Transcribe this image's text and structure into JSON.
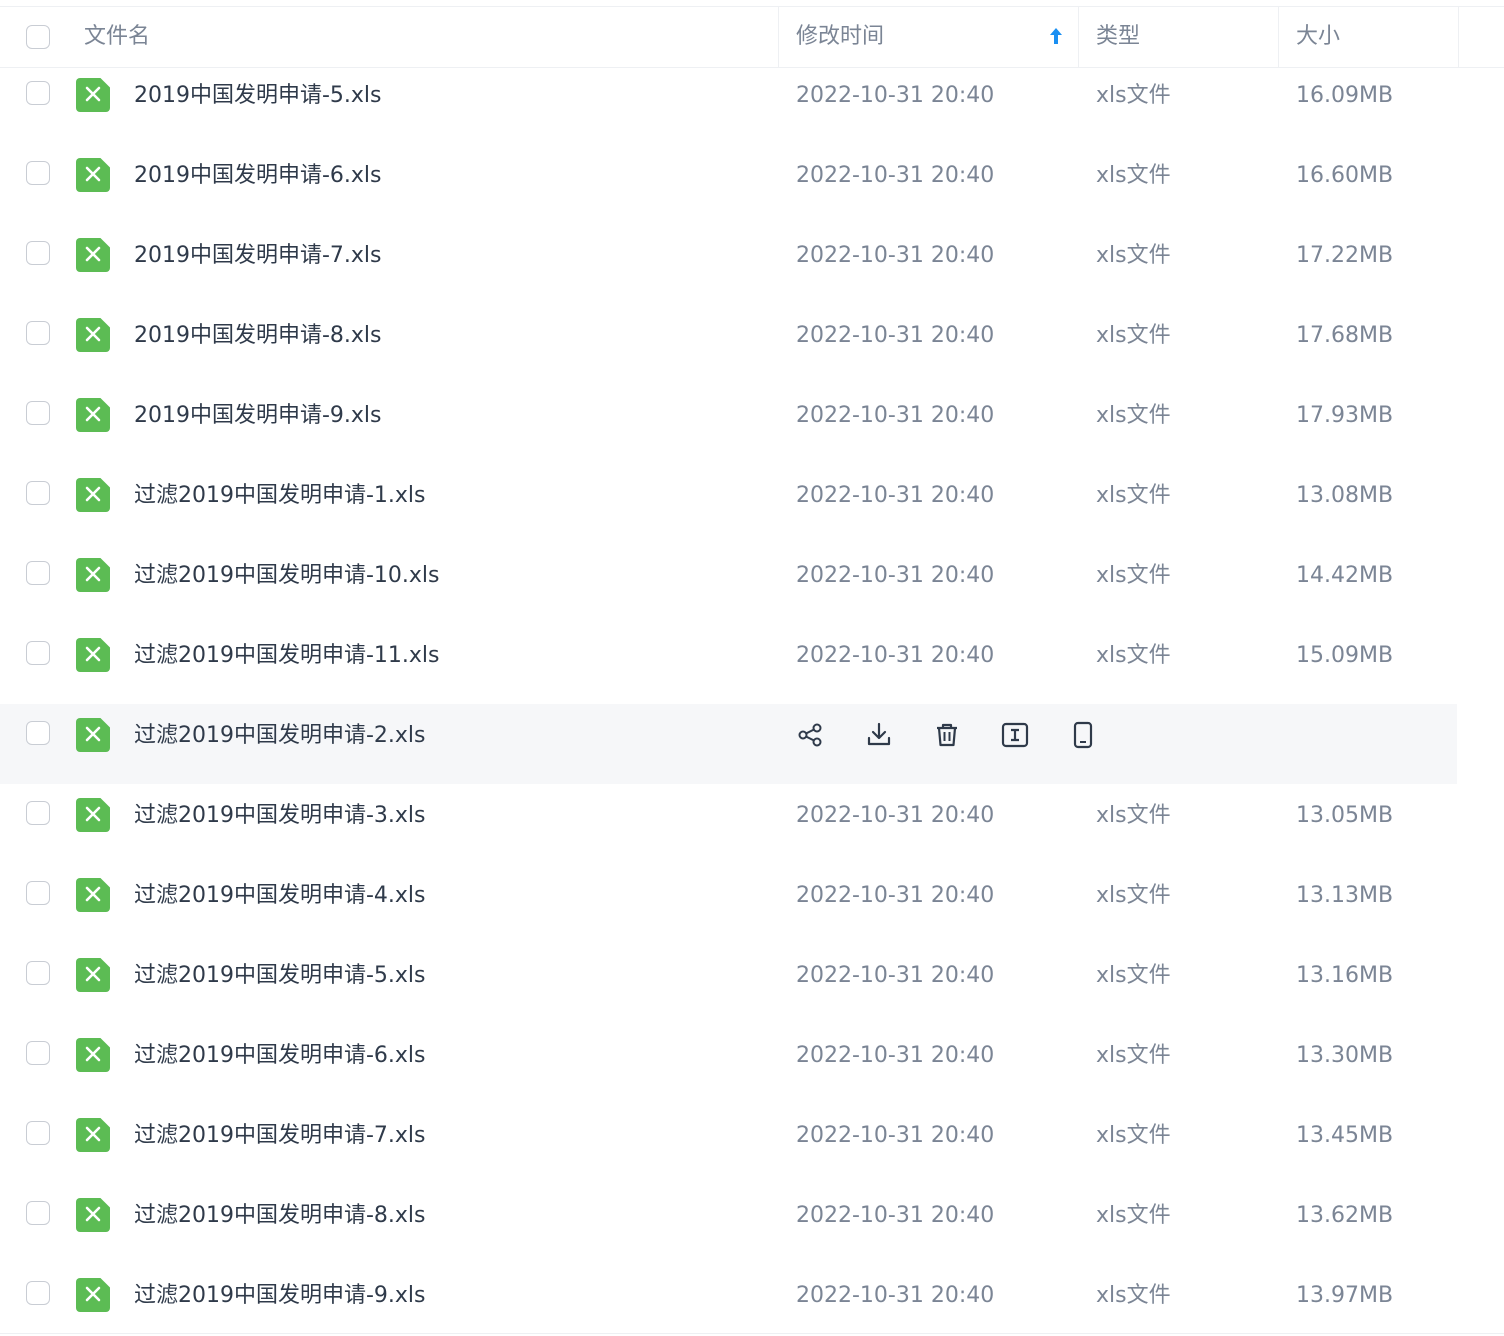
{
  "header": {
    "name_label": "文件名",
    "time_label": "修改时间",
    "type_label": "类型",
    "size_label": "大小"
  },
  "colors": {
    "accent": "#1a8ff2",
    "file_icon": "#5cbc54",
    "hover_row": "#f6f7f9"
  },
  "rows": [
    {
      "name": "2019中国发明申请-5.xls",
      "time": "2022-10-31 20:40",
      "type": "xls文件",
      "size": "16.09MB"
    },
    {
      "name": "2019中国发明申请-6.xls",
      "time": "2022-10-31 20:40",
      "type": "xls文件",
      "size": "16.60MB"
    },
    {
      "name": "2019中国发明申请-7.xls",
      "time": "2022-10-31 20:40",
      "type": "xls文件",
      "size": "17.22MB"
    },
    {
      "name": "2019中国发明申请-8.xls",
      "time": "2022-10-31 20:40",
      "type": "xls文件",
      "size": "17.68MB"
    },
    {
      "name": "2019中国发明申请-9.xls",
      "time": "2022-10-31 20:40",
      "type": "xls文件",
      "size": "17.93MB"
    },
    {
      "name": "过滤2019中国发明申请-1.xls",
      "time": "2022-10-31 20:40",
      "type": "xls文件",
      "size": "13.08MB"
    },
    {
      "name": "过滤2019中国发明申请-10.xls",
      "time": "2022-10-31 20:40",
      "type": "xls文件",
      "size": "14.42MB"
    },
    {
      "name": "过滤2019中国发明申请-11.xls",
      "time": "2022-10-31 20:40",
      "type": "xls文件",
      "size": "15.09MB"
    },
    {
      "name": "过滤2019中国发明申请-2.xls",
      "hover": true
    },
    {
      "name": "过滤2019中国发明申请-3.xls",
      "time": "2022-10-31 20:40",
      "type": "xls文件",
      "size": "13.05MB"
    },
    {
      "name": "过滤2019中国发明申请-4.xls",
      "time": "2022-10-31 20:40",
      "type": "xls文件",
      "size": "13.13MB"
    },
    {
      "name": "过滤2019中国发明申请-5.xls",
      "time": "2022-10-31 20:40",
      "type": "xls文件",
      "size": "13.16MB"
    },
    {
      "name": "过滤2019中国发明申请-6.xls",
      "time": "2022-10-31 20:40",
      "type": "xls文件",
      "size": "13.30MB"
    },
    {
      "name": "过滤2019中国发明申请-7.xls",
      "time": "2022-10-31 20:40",
      "type": "xls文件",
      "size": "13.45MB"
    },
    {
      "name": "过滤2019中国发明申请-8.xls",
      "time": "2022-10-31 20:40",
      "type": "xls文件",
      "size": "13.62MB"
    },
    {
      "name": "过滤2019中国发明申请-9.xls",
      "time": "2022-10-31 20:40",
      "type": "xls文件",
      "size": "13.97MB"
    }
  ],
  "hover_actions": [
    "share-icon",
    "download-icon",
    "delete-icon",
    "rename-icon",
    "mobile-icon"
  ]
}
